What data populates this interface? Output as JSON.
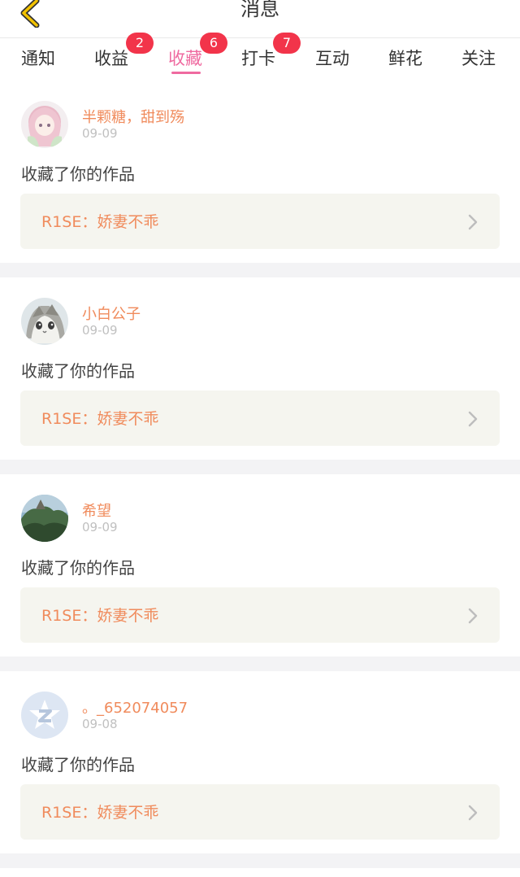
{
  "header": {
    "title": "消息",
    "back_icon": "chevron-left-icon",
    "accent": "#f2c200"
  },
  "tabs": [
    {
      "label": "通知",
      "badge": null,
      "active": false
    },
    {
      "label": "收益",
      "badge": "2",
      "active": false
    },
    {
      "label": "收藏",
      "badge": "6",
      "active": true
    },
    {
      "label": "打卡",
      "badge": "7",
      "active": false
    },
    {
      "label": "互动",
      "badge": null,
      "active": false
    },
    {
      "label": "鲜花",
      "badge": null,
      "active": false
    },
    {
      "label": "关注",
      "badge": null,
      "active": false
    }
  ],
  "colors": {
    "active_tab": "#ef6aa0",
    "badge_bg": "#f2344a",
    "username": "#f08b5c",
    "work_box_bg": "#f5f5ef"
  },
  "messages": [
    {
      "username": "半颗糖，甜到殇",
      "date": "09-09",
      "action": "收藏了你的作品",
      "work_title": "R1SE：娇妻不乖",
      "avatar": "anime-girl-avatar"
    },
    {
      "username": "小白公子",
      "date": "09-09",
      "action": "收藏了你的作品",
      "work_title": "R1SE：娇妻不乖",
      "avatar": "cat-avatar"
    },
    {
      "username": "希望",
      "date": "09-09",
      "action": "收藏了你的作品",
      "work_title": "R1SE：娇妻不乖",
      "avatar": "landscape-avatar"
    },
    {
      "username": "。_652074057",
      "date": "09-08",
      "action": "收藏了你的作品",
      "work_title": "R1SE：娇妻不乖",
      "avatar": "default-qq-avatar"
    }
  ]
}
